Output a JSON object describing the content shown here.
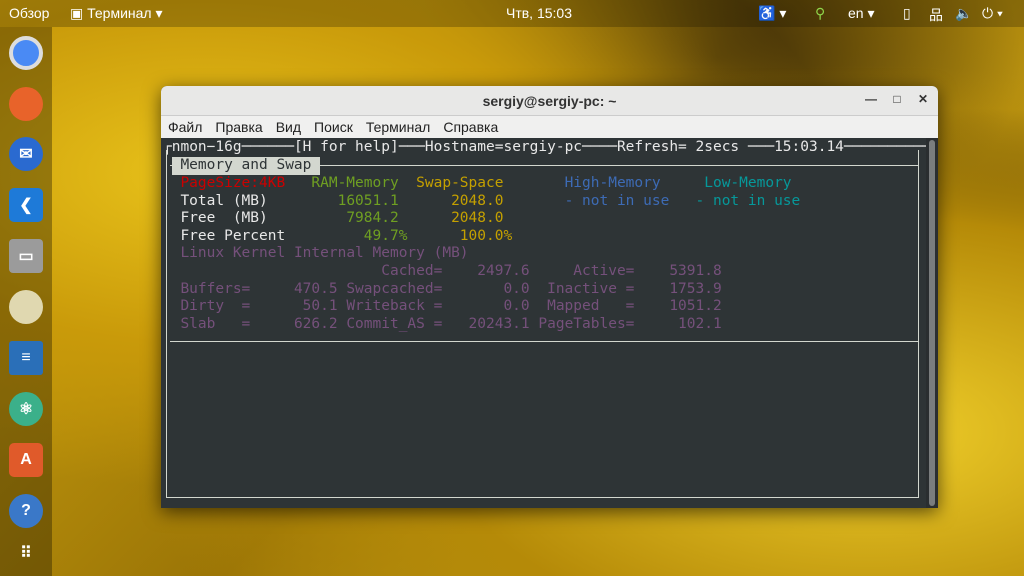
{
  "topbar": {
    "overview": "Обзор",
    "app_menu": "Терминал",
    "clock": "Чтв, 15:03",
    "lang": "en"
  },
  "dock": {
    "items": [
      "chrome",
      "firefox",
      "thunderbird",
      "vscode",
      "files",
      "rhythmbox",
      "writer",
      "atom",
      "software",
      "help",
      "apps"
    ]
  },
  "window": {
    "title": "sergiy@sergiy-pc: ~",
    "menu": [
      "Файл",
      "Правка",
      "Вид",
      "Поиск",
      "Терминал",
      "Справка"
    ]
  },
  "nmon": {
    "header": {
      "prog": "┌nmon−16g",
      "dash1": "──────",
      "help": "[H for help]",
      "dash2": "───",
      "hostname": "Hostname=sergiy-pc",
      "dash3": "────",
      "refresh": "Refresh= 2secs ",
      "dash4": "───",
      "time": "15:03.14",
      "dash5": "──────────────────┐"
    },
    "section": "Memory and Swap",
    "cols": {
      "pagesize": "PageSize:4KB",
      "ram": "RAM-Memory",
      "swap": "Swap-Space",
      "high": "High-Memory",
      "low": "Low-Memory"
    },
    "total": {
      "label": "Total (MB)",
      "ram": "16051.1",
      "swap": "2048.0",
      "high": "- not in use",
      "low": "- not in use"
    },
    "free": {
      "label": "Free  (MB)",
      "ram": "7984.2",
      "swap": "2048.0"
    },
    "percent": {
      "label": "Free Percent",
      "ram": "49.7%",
      "swap": "100.0%"
    },
    "kernel": {
      "title": "Linux Kernel Internal Memory (MB)",
      "cached_l": "Cached=",
      "cached": "2497.6",
      "active_l": "Active=",
      "active": "5391.8",
      "buffers_l": "Buffers=",
      "buffers": "470.5",
      "swapcached_l": "Swapcached=",
      "swapcached": "0.0",
      "inactive_l": "Inactive =",
      "inactive": "1753.9",
      "dirty_l": "Dirty  =",
      "dirty": "50.1",
      "writeback_l": "Writeback =",
      "writeback": "0.0",
      "mapped_l": "Mapped   =",
      "mapped": "1051.2",
      "slab_l": "Slab   =",
      "slab": "626.2",
      "commit_l": "Commit_AS =",
      "commit": "20243.1",
      "pagetables_l": "PageTables=",
      "pagetables": "102.1"
    }
  }
}
